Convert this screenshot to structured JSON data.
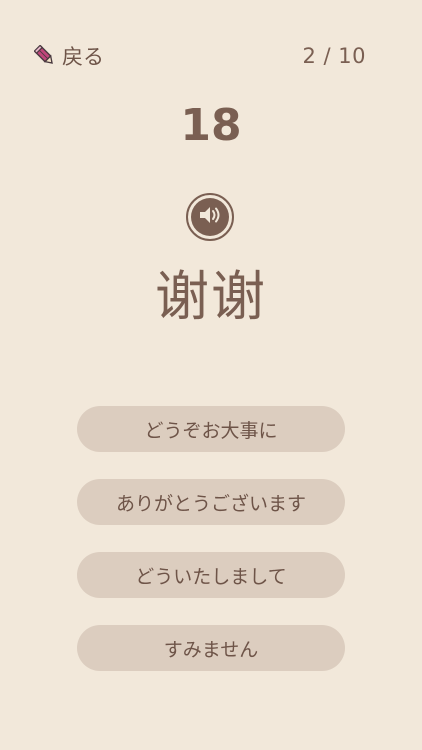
{
  "header": {
    "back_label": "戻る",
    "back_icon": "pencil-icon",
    "progress": "2 / 10"
  },
  "score": "18",
  "sound_icon": "speaker-icon",
  "word": "谢谢",
  "choices": [
    {
      "label": "どうぞお大事に"
    },
    {
      "label": "ありがとうございます"
    },
    {
      "label": "どういたしまして"
    },
    {
      "label": "すみません"
    }
  ],
  "colors": {
    "background": "#f2e8da",
    "text": "#7a5f52",
    "button": "#dccdbf",
    "pencil_accent": "#c0467a"
  }
}
